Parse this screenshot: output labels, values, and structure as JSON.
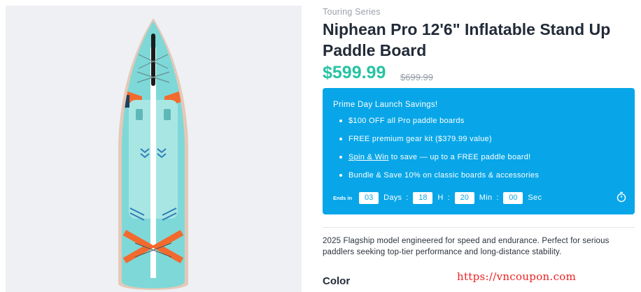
{
  "product": {
    "series": "Touring Series",
    "title": "Niphean Pro 12'6\" Inflatable Stand Up Paddle Board",
    "price": "$599.99",
    "original_price": "$699.99",
    "description": "2025 Flagship model engineered for speed and endurance. Perfect for serious paddlers seeking top-tier performance and long-distance stability.",
    "color_label": "Color"
  },
  "promo": {
    "heading": "Prime Day Launch Savings!",
    "items": {
      "item1": "$100 OFF all Pro paddle boards",
      "item2": "FREE premium gear kit ($379.99 value)",
      "item3_link": "Spin & Win",
      "item3_text": " to save — up to a FREE paddle board!",
      "item4": "Bundle & Save 10% on classic boards & accessories"
    },
    "countdown": {
      "ends_label": "Ends in",
      "days": "03",
      "days_label": "Days",
      "hours": "18",
      "hours_label": "H",
      "minutes": "20",
      "minutes_label": "Min",
      "seconds": "00",
      "seconds_label": "Sec",
      "separator": ":"
    }
  },
  "watermark": "https://vncoupon.com",
  "icons": {
    "timer": "stopwatch-icon",
    "product_image": "paddle-board-image"
  },
  "colors": {
    "price": "#27c3a3",
    "promo_bg": "#08a6e8",
    "board_body": "#7ed8d8",
    "board_accent": "#f26a2e",
    "watermark": "#ee1f1f"
  }
}
